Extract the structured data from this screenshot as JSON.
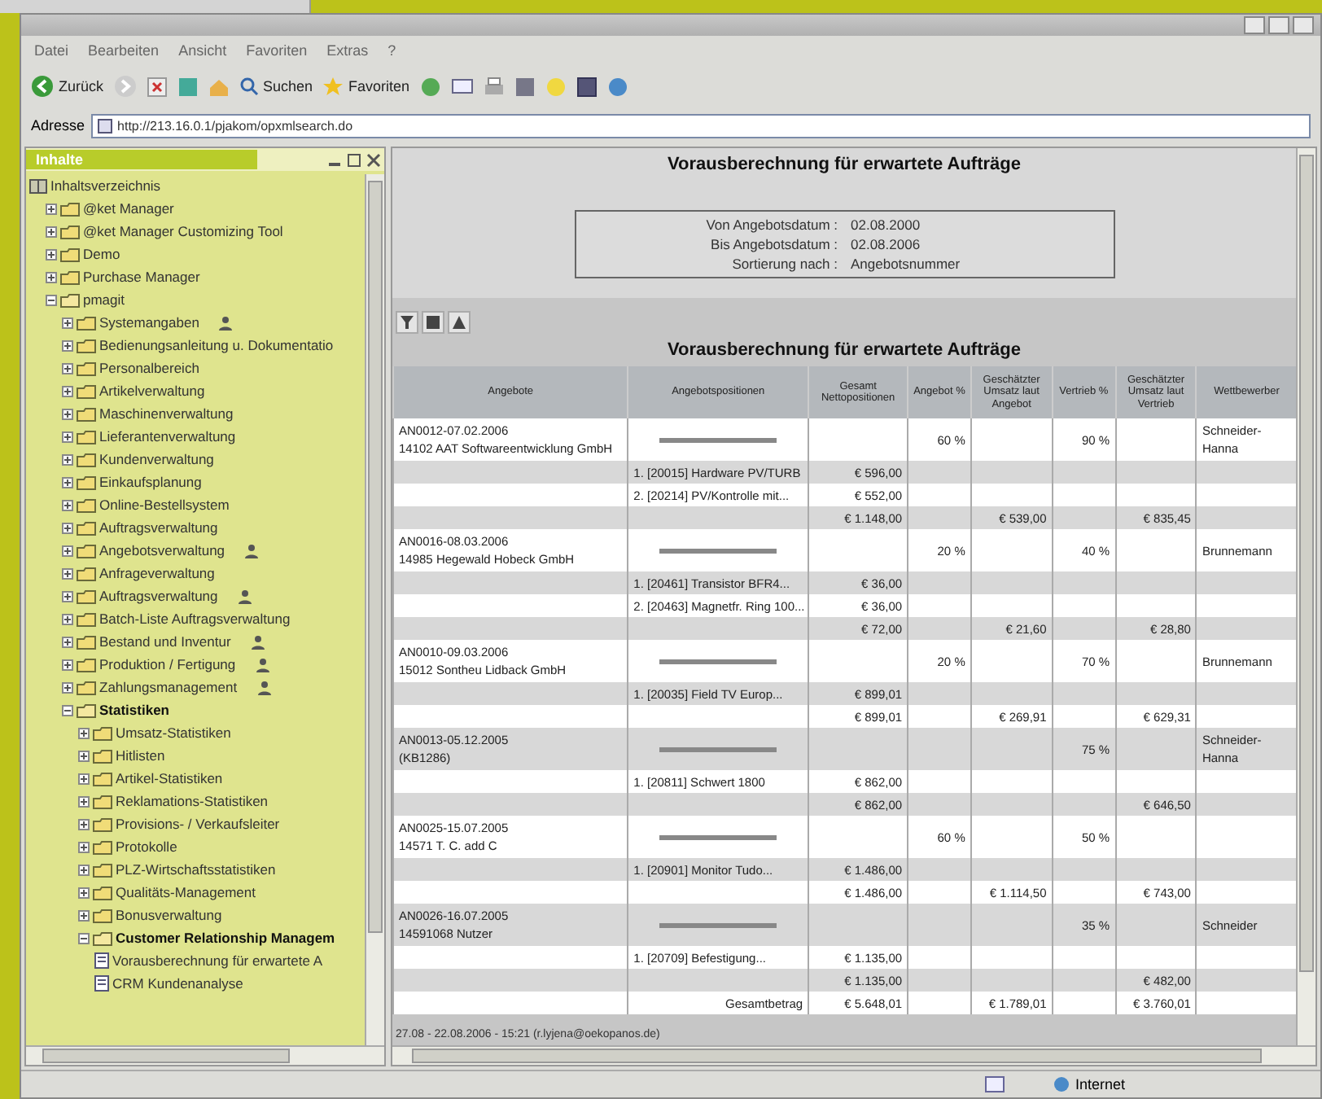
{
  "menu": [
    "Datei",
    "Bearbeiten",
    "Ansicht",
    "Favoriten",
    "Extras",
    "?"
  ],
  "toolbar": {
    "back": "Zurück",
    "search": "Suchen",
    "favorites": "Favoriten"
  },
  "address": {
    "label": "Adresse",
    "value": "http://213.16.0.1/pjakom/opxmlsearch.do"
  },
  "tree_panel": {
    "title": "Inhalte",
    "tree": [
      {
        "label": "Inhaltsverzeichnis",
        "kind": "root",
        "bold": false,
        "badge": false,
        "children": [
          {
            "label": "@ket Manager",
            "kind": "folder",
            "expanded": false,
            "bold": false,
            "badge": false
          },
          {
            "label": "@ket Manager Customizing Tool",
            "kind": "folder",
            "expanded": false,
            "bold": false,
            "badge": false
          },
          {
            "label": "Demo",
            "kind": "folder",
            "expanded": false,
            "bold": false,
            "badge": false
          },
          {
            "label": "Purchase Manager",
            "kind": "folder",
            "expanded": false,
            "bold": false,
            "badge": false
          },
          {
            "label": "pmagit",
            "kind": "folder",
            "expanded": true,
            "bold": false,
            "badge": false,
            "children": [
              {
                "label": "Systemangaben",
                "kind": "folder",
                "expanded": false,
                "bold": false,
                "badge": true
              },
              {
                "label": "Bedienungsanleitung u. Dokumentatio",
                "kind": "folder",
                "expanded": false,
                "bold": false,
                "badge": false
              },
              {
                "label": "Personalbereich",
                "kind": "folder",
                "expanded": false,
                "bold": false,
                "badge": false
              },
              {
                "label": "Artikelverwaltung",
                "kind": "folder",
                "expanded": false,
                "bold": false,
                "badge": false
              },
              {
                "label": "Maschinenverwaltung",
                "kind": "folder",
                "expanded": false,
                "bold": false,
                "badge": false
              },
              {
                "label": "Lieferantenverwaltung",
                "kind": "folder",
                "expanded": false,
                "bold": false,
                "badge": false
              },
              {
                "label": "Kundenverwaltung",
                "kind": "folder",
                "expanded": false,
                "bold": false,
                "badge": false
              },
              {
                "label": "Einkaufsplanung",
                "kind": "folder",
                "expanded": false,
                "bold": false,
                "badge": false
              },
              {
                "label": "Online-Bestellsystem",
                "kind": "folder",
                "expanded": false,
                "bold": false,
                "badge": false
              },
              {
                "label": "Auftragsverwaltung",
                "kind": "folder",
                "expanded": false,
                "bold": false,
                "badge": false
              },
              {
                "label": "Angebotsverwaltung",
                "kind": "folder",
                "expanded": false,
                "bold": false,
                "badge": true
              },
              {
                "label": "Anfrageverwaltung",
                "kind": "folder",
                "expanded": false,
                "bold": false,
                "badge": false
              },
              {
                "label": "Auftragsverwaltung",
                "kind": "folder",
                "expanded": false,
                "bold": false,
                "badge": true
              },
              {
                "label": "Batch-Liste Auftragsverwaltung",
                "kind": "folder",
                "expanded": false,
                "bold": false,
                "badge": false
              },
              {
                "label": "Bestand und Inventur",
                "kind": "folder",
                "expanded": false,
                "bold": false,
                "badge": true
              },
              {
                "label": "Produktion / Fertigung",
                "kind": "folder",
                "expanded": false,
                "bold": false,
                "badge": true
              },
              {
                "label": "Zahlungsmanagement",
                "kind": "folder",
                "expanded": false,
                "bold": false,
                "badge": true
              },
              {
                "label": "Statistiken",
                "kind": "folder",
                "expanded": true,
                "bold": true,
                "badge": false,
                "children": [
                  {
                    "label": "Umsatz-Statistiken",
                    "kind": "folder",
                    "expanded": false,
                    "bold": false,
                    "badge": false
                  },
                  {
                    "label": "Hitlisten",
                    "kind": "folder",
                    "expanded": false,
                    "bold": false,
                    "badge": false
                  },
                  {
                    "label": "Artikel-Statistiken",
                    "kind": "folder",
                    "expanded": false,
                    "bold": false,
                    "badge": false
                  },
                  {
                    "label": "Reklamations-Statistiken",
                    "kind": "folder",
                    "expanded": false,
                    "bold": false,
                    "badge": false
                  },
                  {
                    "label": "Provisions- / Verkaufsleiter",
                    "kind": "folder",
                    "expanded": false,
                    "bold": false,
                    "badge": false
                  },
                  {
                    "label": "Protokolle",
                    "kind": "folder",
                    "expanded": false,
                    "bold": false,
                    "badge": false
                  },
                  {
                    "label": "PLZ-Wirtschaftsstatistiken",
                    "kind": "folder",
                    "expanded": false,
                    "bold": false,
                    "badge": false
                  },
                  {
                    "label": "Qualitäts-Management",
                    "kind": "folder",
                    "expanded": false,
                    "bold": false,
                    "badge": false
                  },
                  {
                    "label": "Bonusverwaltung",
                    "kind": "folder",
                    "expanded": false,
                    "bold": false,
                    "badge": false
                  },
                  {
                    "label": "Customer Relationship Managem",
                    "kind": "folder",
                    "expanded": true,
                    "bold": true,
                    "badge": false,
                    "children": [
                      {
                        "label": "Vorausberechnung für erwartete A",
                        "kind": "document",
                        "expanded": false,
                        "bold": false,
                        "badge": false
                      },
                      {
                        "label": "CRM Kundenanalyse",
                        "kind": "document",
                        "expanded": false,
                        "bold": false,
                        "badge": false
                      }
                    ]
                  }
                ]
              }
            ]
          }
        ]
      }
    ]
  },
  "report": {
    "title": "Vorausberechnung für erwartete Aufträge",
    "parameters": [
      {
        "label": "Von Angebotsdatum :",
        "value": "02.08.2000"
      },
      {
        "label": "Bis Angebotsdatum :",
        "value": "02.08.2006"
      },
      {
        "label": "Sortierung nach :",
        "value": "Angebotsnummer"
      }
    ],
    "table_title": "Vorausberechnung für erwartete Aufträge",
    "columns": [
      "Angebote",
      "Angebotspositionen",
      "Gesamt Nettopositionen",
      "Angebot %",
      "Geschätzter Umsatz laut Angebot",
      "Vertrieb %",
      "Geschätzter Umsatz laut Vertrieb",
      "Wettbewerber"
    ],
    "rows": [
      {
        "kind": "offer",
        "offer": "AN0012-07.02.2006",
        "customer": "14102 AAT Softwareentwicklung GmbH",
        "offer_pct": "60 %",
        "sales_pct": "90 %",
        "competitor": "Schneider-Hanna"
      },
      {
        "kind": "item",
        "position": "1. [20015] Hardware PV/TURB",
        "net": "€ 596,00"
      },
      {
        "kind": "item",
        "position": "2. [20214] PV/Kontrolle mit...",
        "net": "€ 552,00"
      },
      {
        "kind": "subtotal",
        "net": "€ 1.148,00",
        "est_offer": "€ 539,00",
        "est_sales": "€ 835,45"
      },
      {
        "kind": "offer",
        "offer": "AN0016-08.03.2006",
        "customer": "14985 Hegewald Hobeck GmbH",
        "offer_pct": "20 %",
        "sales_pct": "40 %",
        "competitor": "Brunnemann"
      },
      {
        "kind": "item",
        "position": "1. [20461] Transistor BFR4...",
        "net": "€ 36,00"
      },
      {
        "kind": "item",
        "position": "2. [20463] Magnetfr. Ring 100...",
        "net": "€ 36,00"
      },
      {
        "kind": "subtotal",
        "net": "€ 72,00",
        "est_offer": "€ 21,60",
        "est_sales": "€ 28,80"
      },
      {
        "kind": "offer",
        "offer": "AN0010-09.03.2006",
        "customer": "15012 Sontheu Lidback GmbH",
        "offer_pct": "20 %",
        "sales_pct": "70 %",
        "competitor": "Brunnemann"
      },
      {
        "kind": "item",
        "position": "1. [20035] Field TV Europ...",
        "net": "€ 899,01"
      },
      {
        "kind": "subtotal",
        "net": "€ 899,01",
        "est_offer": "€ 269,91",
        "est_sales": "€ 629,31"
      },
      {
        "kind": "offer",
        "offer": "AN0013-05.12.2005",
        "customer": "(KB1286)",
        "sales_pct": "75 %",
        "competitor": "Schneider-Hanna"
      },
      {
        "kind": "item",
        "position": "1. [20811] Schwert 1800",
        "net": "€ 862,00"
      },
      {
        "kind": "subtotal",
        "net": "€ 862,00",
        "est_sales": "€ 646,50"
      },
      {
        "kind": "offer",
        "offer": "AN0025-15.07.2005",
        "customer": "14571 T. C. add C",
        "offer_pct": "60 %",
        "sales_pct": "50 %"
      },
      {
        "kind": "item",
        "position": "1. [20901] Monitor Tudo...",
        "net": "€ 1.486,00"
      },
      {
        "kind": "subtotal",
        "net": "€ 1.486,00",
        "est_offer": "€ 1.114,50",
        "est_sales": "€ 743,00"
      },
      {
        "kind": "offer",
        "offer": "AN0026-16.07.2005",
        "customer": "14591068 Nutzer",
        "sales_pct": "35 %",
        "competitor": "Schneider"
      },
      {
        "kind": "item",
        "position": "1. [20709] Befestigung...",
        "net": "€ 1.135,00"
      },
      {
        "kind": "subtotal",
        "net": "€ 1.135,00",
        "est_sales": "€ 482,00"
      },
      {
        "kind": "total",
        "label": "Gesamtbetrag",
        "net": "€ 5.648,01",
        "est_offer": "€ 1.789,01",
        "est_sales": "€ 3.760,01"
      }
    ],
    "footer": "27.08 - 22.08.2006 - 15:21 (r.lyjena@oekopanos.de)"
  },
  "status_bar": {
    "zone": "Internet"
  }
}
